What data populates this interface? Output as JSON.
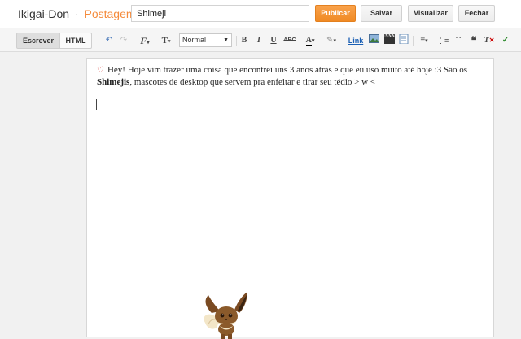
{
  "header": {
    "blog_name": "Ikigai-Don",
    "separator": "·",
    "section": "Postagem",
    "post_title": "Shimeji",
    "publish_label": "Publicar",
    "save_label": "Salvar",
    "preview_label": "Visualizar",
    "close_label": "Fechar"
  },
  "toolbar": {
    "write_label": "Escrever",
    "html_label": "HTML",
    "font_size_format": "Normal",
    "link_label": "Link",
    "icons": [
      "undo-icon",
      "redo-icon",
      "font-family-icon",
      "font-size-icon",
      "bold-icon",
      "italic-icon",
      "underline-icon",
      "strikethrough-icon",
      "text-color-icon",
      "highlight-icon",
      "link",
      "image-icon",
      "video-icon",
      "jump-break-icon",
      "align-icon",
      "numbered-list-icon",
      "bulleted-list-icon",
      "quote-icon",
      "remove-format-icon",
      "spellcheck-icon"
    ]
  },
  "post": {
    "text_before": "Hey! Hoje vim trazer uma coisa que encontrei uns 3 anos atrás e que eu uso muito até hoje :3 São os ",
    "text_bold": "Shimejis",
    "text_after": ", mascotes de desktop que servem pra enfeitar e tirar seu tédio > w <"
  },
  "colors": {
    "accent": "#f58b3c",
    "publish_bg": "#f08a24"
  }
}
